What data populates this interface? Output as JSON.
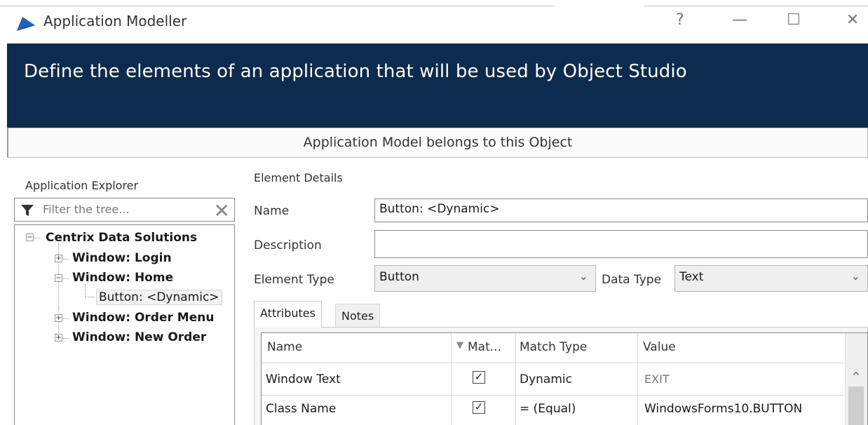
{
  "window": {
    "title": "Application Modeller",
    "controls": {
      "help": "?",
      "minimize": "—",
      "maximize": "☐",
      "close": "✕"
    }
  },
  "banner": {
    "text": "Define the elements of an application that will be used by Object Studio"
  },
  "object_bar": {
    "text": "Application Model belongs to this Object"
  },
  "explorer": {
    "label": "Application Explorer",
    "filter_placeholder": "Filter the tree...",
    "tree": {
      "root": "Centrix Data Solutions",
      "items": [
        {
          "label": "Window: Login",
          "expander": "+"
        },
        {
          "label": "Window: Home",
          "expander": "−"
        },
        {
          "label": "Button: <Dynamic>"
        },
        {
          "label": "Window: Order Menu",
          "expander": "+"
        },
        {
          "label": "Window: New Order",
          "expander": "+"
        }
      ]
    }
  },
  "details": {
    "heading": "Element Details",
    "name_label": "Name",
    "name_value": "Button: <Dynamic>",
    "description_label": "Description",
    "description_value": "",
    "element_type_label": "Element Type",
    "element_type_value": "Button",
    "data_type_label": "Data Type",
    "data_type_value": "Text"
  },
  "tabs": [
    {
      "label": "Attributes",
      "active": true
    },
    {
      "label": "Notes",
      "active": false
    }
  ],
  "attributes": {
    "columns": [
      "Name",
      "Mat...",
      "Match Type",
      "Value"
    ],
    "rows": [
      {
        "name": "Window Text",
        "match": true,
        "match_type": "Dynamic",
        "value": "EXIT"
      },
      {
        "name": "Class Name",
        "match": true,
        "match_type": "= (Equal)",
        "value": "WindowsForms10.BUTTON"
      }
    ]
  },
  "colors": {
    "banner": "#0c2b4e",
    "logo": "#1f5fbf"
  }
}
